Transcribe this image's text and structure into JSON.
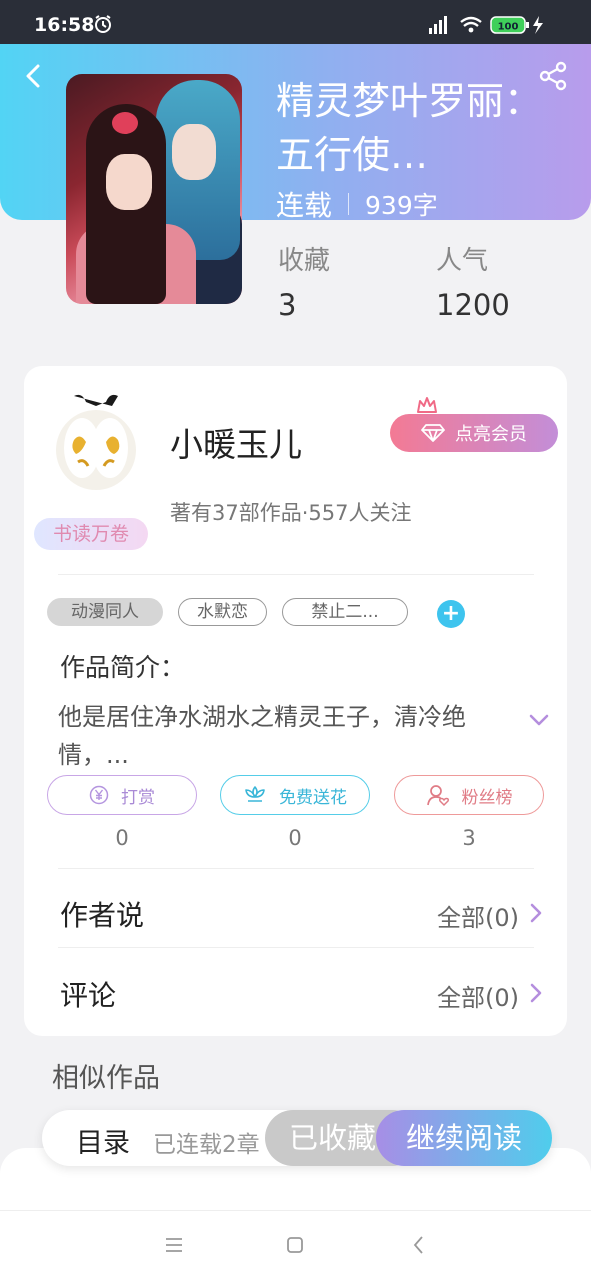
{
  "status_bar": {
    "time": "16:58",
    "battery": "100"
  },
  "book": {
    "title": "精灵梦叶罗丽：五行使…",
    "status": "连载",
    "word_count": "939字"
  },
  "stats": [
    {
      "label": "收藏",
      "value": "3"
    },
    {
      "label": "人气",
      "value": "1200"
    }
  ],
  "author": {
    "name": "小暖玉儿",
    "badge": "书读万卷",
    "meta": "著有37部作品·557人关注",
    "vip_button": "点亮会员"
  },
  "tags": [
    "动漫同人",
    "水默恋",
    "禁止二..."
  ],
  "tag_add": "+",
  "intro": {
    "title": "作品简介：",
    "text": "他是居住净水湖水之精灵王子，清冷绝情，..."
  },
  "actions": [
    {
      "label": "打赏",
      "count": "0"
    },
    {
      "label": "免费送花",
      "count": "0"
    },
    {
      "label": "粉丝榜",
      "count": "3"
    }
  ],
  "rows": {
    "author_says": {
      "label": "作者说",
      "value": "全部(0)"
    },
    "comments": {
      "label": "评论",
      "value": "全部(0)"
    }
  },
  "similar_title": "相似作品",
  "bottom": {
    "toc": "目录",
    "progress": "已连载2章",
    "collected": "已收藏",
    "read": "继续阅读"
  },
  "colors": {
    "header_start": "#52d4f4",
    "header_end": "#b89cec",
    "accent_blue": "#3ec4ee",
    "vip_pink": "#f37a94"
  }
}
